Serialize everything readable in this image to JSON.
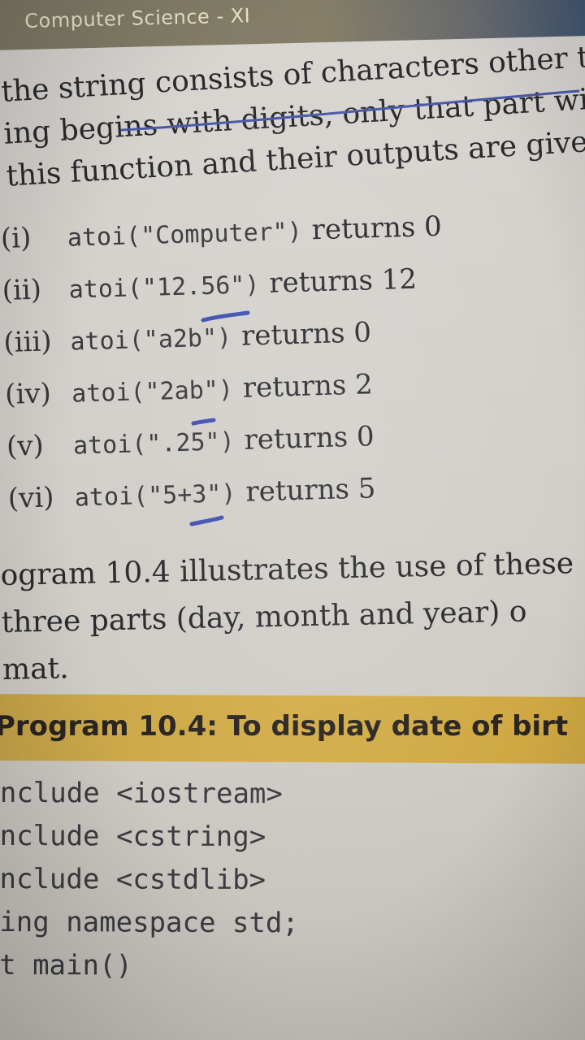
{
  "header": {
    "title": "Computer Science - XI"
  },
  "paragraph": {
    "lines": [
      "the string consists of characters other th",
      "ing begins with digits, only that part will",
      "this function and their outputs are give"
    ]
  },
  "examples": [
    {
      "num": "(i)",
      "code": "atoi(\"Computer\")",
      "result": "returns 0"
    },
    {
      "num": "(ii)",
      "code": "atoi(\"12.56\")",
      "result": "returns 12"
    },
    {
      "num": "(iii)",
      "code": "atoi(\"a2b\")",
      "result": "returns 0"
    },
    {
      "num": "(iv)",
      "code": "atoi(\"2ab\")",
      "result": "returns 2"
    },
    {
      "num": "(v)",
      "code": "atoi(\".25\")",
      "result": "returns 0"
    },
    {
      "num": "(vi)",
      "code": "atoi(\"5+3\")",
      "result": "returns 5"
    }
  ],
  "paragraph2": {
    "lines": [
      "ogram 10.4 illustrates the use of these",
      "three parts (day, month and year) o",
      "mat."
    ]
  },
  "program": {
    "title": "Program 10.4: To display date of birt",
    "code_lines": [
      "nclude <iostream>",
      "nclude <cstring>",
      "nclude <cstdlib>",
      "ing namespace std;",
      "t main()"
    ]
  }
}
